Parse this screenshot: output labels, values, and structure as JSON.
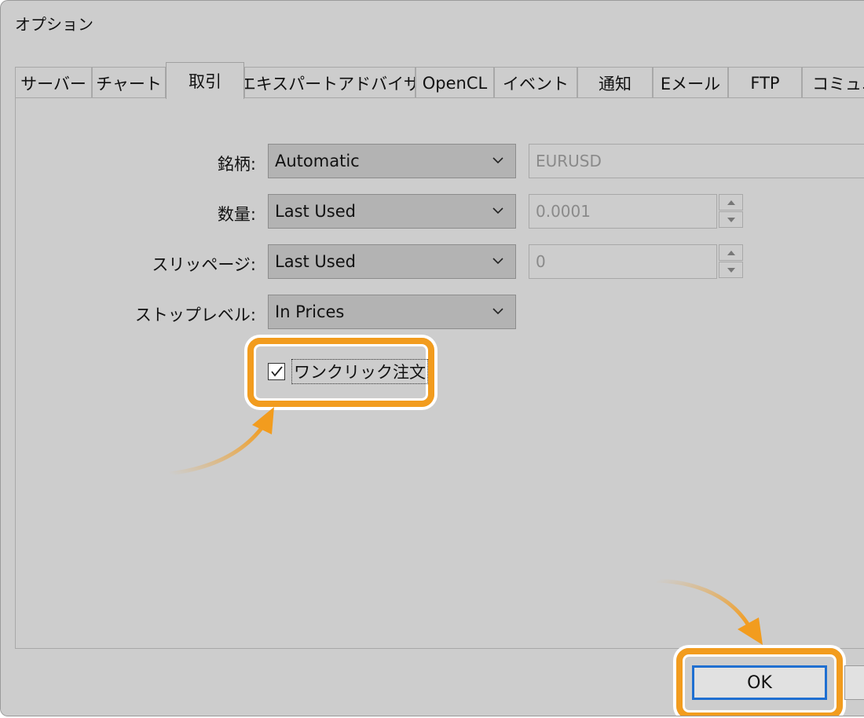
{
  "window": {
    "title": "オプション"
  },
  "tabs": [
    {
      "label": "サーバー"
    },
    {
      "label": "チャート"
    },
    {
      "label": "取引",
      "active": true
    },
    {
      "label": "エキスパートアドバイザ"
    },
    {
      "label": "OpenCL"
    },
    {
      "label": "イベント"
    },
    {
      "label": "通知"
    },
    {
      "label": "Eメール"
    },
    {
      "label": "FTP"
    },
    {
      "label": "コミュニ"
    }
  ],
  "form": {
    "symbol": {
      "label": "銘柄:",
      "value": "Automatic",
      "field": "EURUSD"
    },
    "volume": {
      "label": "数量:",
      "value": "Last Used",
      "field": "0.0001"
    },
    "slippage": {
      "label": "スリッページ:",
      "value": "Last Used",
      "field": "0"
    },
    "stoplevel": {
      "label": "ストップレベル:",
      "value": "In Prices"
    },
    "oneclick": {
      "label": "ワンクリック注文",
      "checked": true
    }
  },
  "buttons": {
    "ok": "OK"
  },
  "colors": {
    "highlight": "#f29c1e",
    "ok_border": "#1f6fd1"
  }
}
